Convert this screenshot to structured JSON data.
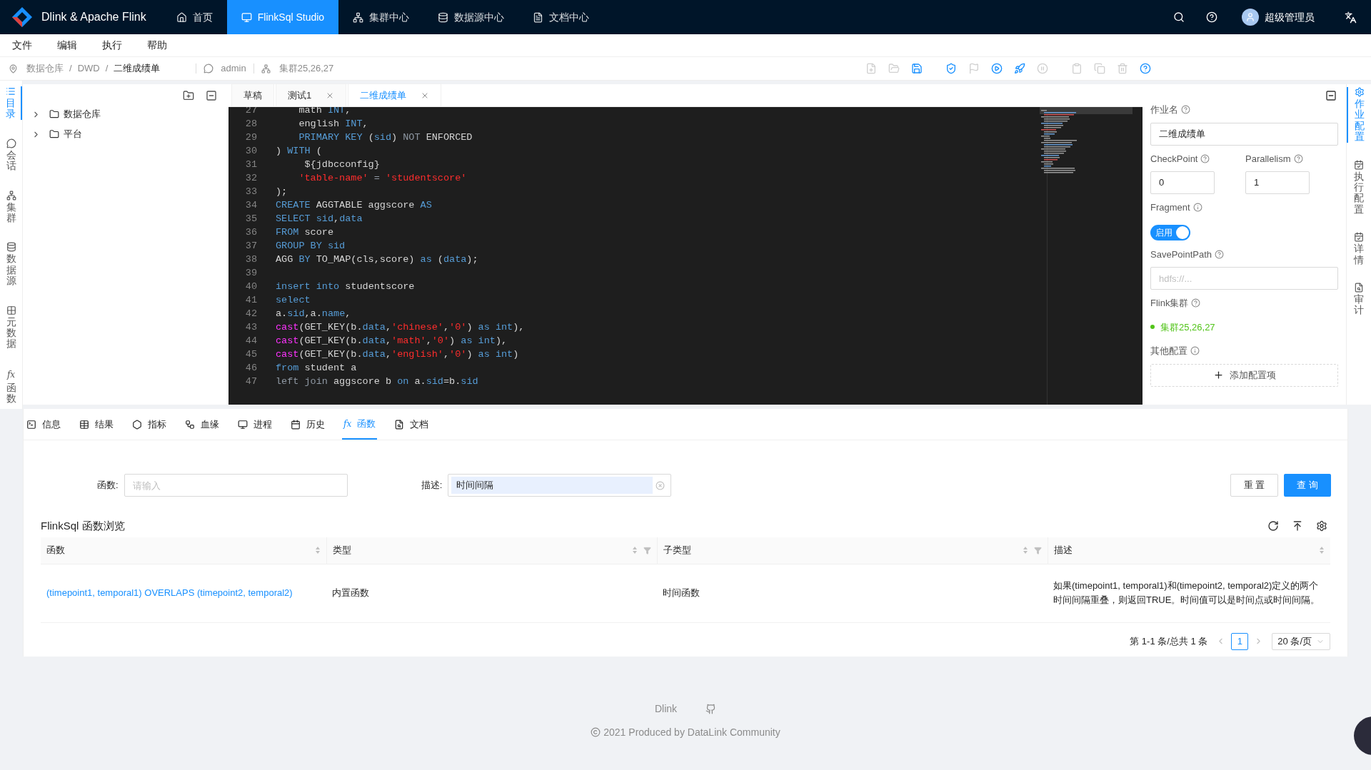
{
  "header": {
    "brand": "Dlink & Apache Flink",
    "nav": [
      {
        "kind": "home",
        "label": "首页",
        "selected": false
      },
      {
        "kind": "monitor",
        "label": "FlinkSql Studio",
        "selected": true
      },
      {
        "kind": "cluster",
        "label": "集群中心",
        "selected": false
      },
      {
        "kind": "database",
        "label": "数据源中心",
        "selected": false
      },
      {
        "kind": "doc",
        "label": "文档中心",
        "selected": false
      }
    ],
    "user": "超级管理员"
  },
  "menu": [
    "文件",
    "编辑",
    "执行",
    "帮助"
  ],
  "breadcrumb": {
    "path": [
      "数据仓库",
      "DWD",
      "二维成绩单"
    ],
    "separator": "/",
    "session": "admin",
    "cluster": "集群25,26,27",
    "toolbar": [
      {
        "kind": "new",
        "disabled": true
      },
      {
        "kind": "open",
        "disabled": true
      },
      {
        "kind": "save",
        "disabled": false
      },
      {
        "kind": "check",
        "disabled": false
      },
      {
        "kind": "flag",
        "disabled": true
      },
      {
        "kind": "run",
        "disabled": false
      },
      {
        "kind": "deploy",
        "disabled": false
      },
      {
        "kind": "pause",
        "disabled": true
      },
      {
        "kind": "paste",
        "disabled": true
      },
      {
        "kind": "copy",
        "disabled": true
      },
      {
        "kind": "delete",
        "disabled": true
      },
      {
        "kind": "help",
        "disabled": false
      }
    ]
  },
  "left_tabs": [
    {
      "kind": "list",
      "label": "目录",
      "selected": true
    },
    {
      "kind": "chat",
      "label": "会话",
      "selected": false
    },
    {
      "kind": "cluster",
      "label": "集群",
      "selected": false
    },
    {
      "kind": "database",
      "label": "数据源",
      "selected": false
    },
    {
      "kind": "grid",
      "label": "元数据",
      "selected": false
    },
    {
      "kind": "fx",
      "label": "函数",
      "selected": false
    }
  ],
  "tree": [
    {
      "label": "数据仓库",
      "expanded": false
    },
    {
      "label": "平台",
      "expanded": false
    }
  ],
  "editor_tabs": [
    {
      "label": "草稿",
      "closable": false,
      "selected": false
    },
    {
      "label": "测试1",
      "closable": true,
      "selected": false
    },
    {
      "label": "二维成绩单",
      "closable": true,
      "selected": true
    }
  ],
  "code_lines": [
    {
      "number": "27",
      "tokens": [
        {
          "text": "    math ",
          "kind": "plain"
        },
        {
          "text": "INT",
          "kind": "keyword"
        },
        {
          "text": ",",
          "kind": "plain"
        }
      ]
    },
    {
      "number": "28",
      "tokens": [
        {
          "text": "    english ",
          "kind": "plain"
        },
        {
          "text": "INT",
          "kind": "keyword"
        },
        {
          "text": ",",
          "kind": "plain"
        }
      ]
    },
    {
      "number": "29",
      "tokens": [
        {
          "text": "    PRIMARY KEY",
          "kind": "keyword"
        },
        {
          "text": " (",
          "kind": "plain"
        },
        {
          "text": "sid",
          "kind": "keyword"
        },
        {
          "text": ") ",
          "kind": "plain"
        },
        {
          "text": "NOT",
          "kind": "dim"
        },
        {
          "text": " ENFORCED",
          "kind": "plain"
        }
      ]
    },
    {
      "number": "30",
      "tokens": [
        {
          "text": ") ",
          "kind": "plain"
        },
        {
          "text": "WITH",
          "kind": "keyword"
        },
        {
          "text": " (",
          "kind": "plain"
        }
      ]
    },
    {
      "number": "31",
      "tokens": [
        {
          "text": "     ${jdbcconfig}",
          "kind": "plain"
        }
      ]
    },
    {
      "number": "32",
      "tokens": [
        {
          "text": "    'table-name'",
          "kind": "string"
        },
        {
          "text": " = ",
          "kind": "dim"
        },
        {
          "text": "'studentscore'",
          "kind": "string"
        }
      ]
    },
    {
      "number": "33",
      "tokens": [
        {
          "text": ");",
          "kind": "plain"
        }
      ]
    },
    {
      "number": "34",
      "tokens": [
        {
          "text": "CREATE",
          "kind": "keyword"
        },
        {
          "text": " AGGTABLE aggscore ",
          "kind": "plain"
        },
        {
          "text": "AS",
          "kind": "keyword"
        }
      ]
    },
    {
      "number": "35",
      "tokens": [
        {
          "text": "SELECT",
          "kind": "keyword"
        },
        {
          "text": " sid",
          "kind": "keyword"
        },
        {
          "text": ",",
          "kind": "plain"
        },
        {
          "text": "data",
          "kind": "keyword"
        }
      ]
    },
    {
      "number": "36",
      "tokens": [
        {
          "text": "FROM",
          "kind": "keyword"
        },
        {
          "text": " score",
          "kind": "plain"
        }
      ]
    },
    {
      "number": "37",
      "tokens": [
        {
          "text": "GROUP BY sid",
          "kind": "keyword"
        }
      ]
    },
    {
      "number": "38",
      "tokens": [
        {
          "text": "AGG ",
          "kind": "plain"
        },
        {
          "text": "BY",
          "kind": "keyword"
        },
        {
          "text": " TO_MAP(cls,score) ",
          "kind": "plain"
        },
        {
          "text": "as",
          "kind": "keyword"
        },
        {
          "text": " (",
          "kind": "plain"
        },
        {
          "text": "data",
          "kind": "keyword"
        },
        {
          "text": ");",
          "kind": "plain"
        }
      ]
    },
    {
      "number": "39"
    },
    {
      "number": "40",
      "tokens": [
        {
          "text": "insert into",
          "kind": "keyword"
        },
        {
          "text": " studentscore",
          "kind": "plain"
        }
      ]
    },
    {
      "number": "41",
      "tokens": [
        {
          "text": "select",
          "kind": "keyword"
        }
      ]
    },
    {
      "number": "42",
      "tokens": [
        {
          "text": "a.",
          "kind": "plain"
        },
        {
          "text": "sid",
          "kind": "keyword"
        },
        {
          "text": ",a.",
          "kind": "plain"
        },
        {
          "text": "name",
          "kind": "keyword"
        },
        {
          "text": ",",
          "kind": "plain"
        }
      ]
    },
    {
      "number": "43",
      "tokens": [
        {
          "text": "cast",
          "kind": "function"
        },
        {
          "text": "(GET_KEY(b.",
          "kind": "plain"
        },
        {
          "text": "data",
          "kind": "keyword"
        },
        {
          "text": ",",
          "kind": "plain"
        },
        {
          "text": "'chinese'",
          "kind": "string"
        },
        {
          "text": ",",
          "kind": "plain"
        },
        {
          "text": "'0'",
          "kind": "string"
        },
        {
          "text": ") ",
          "kind": "plain"
        },
        {
          "text": "as int",
          "kind": "keyword"
        },
        {
          "text": "),",
          "kind": "plain"
        }
      ]
    },
    {
      "number": "44",
      "tokens": [
        {
          "text": "cast",
          "kind": "function"
        },
        {
          "text": "(GET_KEY(b.",
          "kind": "plain"
        },
        {
          "text": "data",
          "kind": "keyword"
        },
        {
          "text": ",",
          "kind": "plain"
        },
        {
          "text": "'math'",
          "kind": "string"
        },
        {
          "text": ",",
          "kind": "plain"
        },
        {
          "text": "'0'",
          "kind": "string"
        },
        {
          "text": ") ",
          "kind": "plain"
        },
        {
          "text": "as int",
          "kind": "keyword"
        },
        {
          "text": "),",
          "kind": "plain"
        }
      ]
    },
    {
      "number": "45",
      "tokens": [
        {
          "text": "cast",
          "kind": "function"
        },
        {
          "text": "(GET_KEY(b.",
          "kind": "plain"
        },
        {
          "text": "data",
          "kind": "keyword"
        },
        {
          "text": ",",
          "kind": "plain"
        },
        {
          "text": "'english'",
          "kind": "string"
        },
        {
          "text": ",",
          "kind": "plain"
        },
        {
          "text": "'0'",
          "kind": "string"
        },
        {
          "text": ") ",
          "kind": "plain"
        },
        {
          "text": "as int",
          "kind": "keyword"
        },
        {
          "text": ")",
          "kind": "plain"
        }
      ]
    },
    {
      "number": "46",
      "tokens": [
        {
          "text": "from",
          "kind": "keyword"
        },
        {
          "text": " student a",
          "kind": "plain"
        }
      ]
    },
    {
      "number": "47",
      "tokens": [
        {
          "text": "left join",
          "kind": "dim"
        },
        {
          "text": " aggscore b ",
          "kind": "plain"
        },
        {
          "text": "on",
          "kind": "keyword"
        },
        {
          "text": " a.",
          "kind": "plain"
        },
        {
          "text": "sid",
          "kind": "keyword"
        },
        {
          "text": "=b.",
          "kind": "plain"
        },
        {
          "text": "sid",
          "kind": "keyword"
        }
      ]
    }
  ],
  "job_config": {
    "job_name_label": "作业名",
    "job_name": "二维成绩单",
    "checkpoint_label": "CheckPoint",
    "checkpoint": "0",
    "parallelism_label": "Parallelism",
    "parallelism": "1",
    "fragment_label": "Fragment",
    "fragment": {
      "label": "启用",
      "on": true
    },
    "savepoint_label": "SavePointPath",
    "savepoint_placeholder": "hdfs://...",
    "cluster_label": "Flink集群",
    "cluster": {
      "name": "集群25,26,27",
      "color": "#52c41a"
    },
    "other_label": "其他配置",
    "add_button": "添加配置项"
  },
  "right_tabs": [
    {
      "kind": "gear",
      "label": "作业配置",
      "selected": true
    },
    {
      "kind": "calendar",
      "label": "执行配置",
      "selected": false
    },
    {
      "kind": "calendar",
      "label": "详情",
      "selected": false
    },
    {
      "kind": "audit",
      "label": "审计",
      "selected": false
    }
  ],
  "bottom_tabs": [
    {
      "kind": "terminal",
      "label": "信息",
      "selected": false
    },
    {
      "kind": "table",
      "label": "结果",
      "selected": false
    },
    {
      "kind": "gauge",
      "label": "指标",
      "selected": false
    },
    {
      "kind": "lineage",
      "label": "血缘",
      "selected": false
    },
    {
      "kind": "monitor",
      "label": "进程",
      "selected": false
    },
    {
      "kind": "calendar",
      "label": "历史",
      "selected": false
    },
    {
      "kind": "fx",
      "label": "函数",
      "selected": true
    },
    {
      "kind": "doc",
      "label": "文档",
      "selected": false
    }
  ],
  "search": {
    "function_label": "函数:",
    "function_placeholder": "请输入",
    "desc_label": "描述:",
    "desc_value": "时间间隔",
    "reset": "重 置",
    "query": "查 询"
  },
  "table": {
    "title": "FlinkSql 函数浏览",
    "columns": [
      {
        "label": "函数",
        "filter": false
      },
      {
        "label": "类型",
        "filter": true
      },
      {
        "label": "子类型",
        "filter": true
      },
      {
        "label": "描述",
        "filter": false
      }
    ],
    "rows": [
      {
        "function": "(timepoint1, temporal1) OVERLAPS (timepoint2, temporal2)",
        "type": "内置函数",
        "subtype": "时间函数",
        "description": "如果(timepoint1, temporal1)和(timepoint2, temporal2)定义的两个时间间隔重叠，则返回TRUE。时间值可以是时间点或时间间隔。"
      }
    ]
  },
  "pagination": {
    "summary": "第 1-1 条/总共 1 条",
    "pages": [
      {
        "label": "1",
        "selected": true
      }
    ],
    "page_size": "20 条/页"
  },
  "footer": {
    "name": "Dlink",
    "copyright": "2021 Produced by DataLink Community"
  }
}
